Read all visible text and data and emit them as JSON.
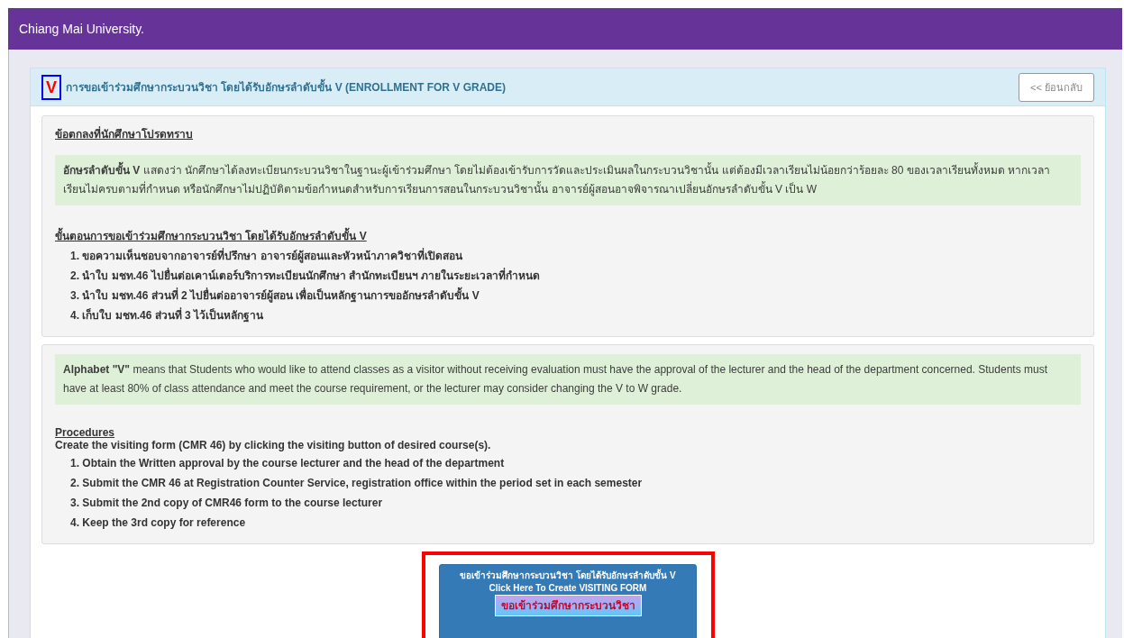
{
  "header": {
    "title": "Chiang Mai University."
  },
  "panel": {
    "badge": "V",
    "title": "การขอเข้าร่วมศึกษากระบวนวิชา โดยได้รับอักษรลำดับขั้น V (ENROLLMENT FOR V GRADE)",
    "back_button": "<< ย้อนกลับ"
  },
  "sections": [
    {
      "heading": "ข้อตกลงที่นักศึกษาโปรดทราบ",
      "notice": "**อักษรลำดับขั้น V** แสดงว่า นักศึกษาได้ลงทะเบียนกระบวนวิชาในฐานะผู้เข้าร่วมศึกษา โดยไม่ต้องเข้ารับการวัดและประเมินผลในกระบวนวิชานั้น แต่ต้องมีเวลาเรียนไม่น้อยกว่าร้อยละ 80 ของเวลาเรียนทั้งหมด หากเวลาเรียนไม่ครบตามที่กำหนด หรือนักศึกษาไม่ปฏิบัติตามข้อกำหนดสำหรับการเรียนการสอนในกระบวนวิชานั้น อาจารย์ผู้สอนอาจพิจารณาเปลี่ยนอักษรลำดับขั้น V เป็น W",
      "steps_heading": "ขั้นตอนการขอเข้าร่วมศึกษากระบวนวิชา โดยได้รับอักษรลำดับขั้น V",
      "steps": [
        "1. ขอความเห็นชอบจากอาจารย์ที่ปรึกษา อาจารย์ผู้สอนและหัวหน้าภาควิชาที่เปิดสอน",
        "2. นำใบ มชท.46 ไปยื่นต่อเคาน์เตอร์บริการทะเบียนนักศึกษา สำนักทะเบียนฯ ภายในระยะเวลาที่กำหนด",
        "3. นำใบ มชท.46 ส่วนที่ 2 ไปยื่นต่ออาจารย์ผู้สอน เพื่อเป็นหลักฐานการขออักษรลำดับขั้น V",
        "4. เก็บใบ มชท.46 ส่วนที่ 3 ไว้เป็นหลักฐาน"
      ]
    },
    {
      "notice": "**Alphabet \"V\"** means that Students who would like to attend classes as a visitor without receiving evaluation must have the approval of the lecturer and the head of the department concerned. Students must have at least 80% of class attendance and meet the course requirement, or the lecturer may consider changing the V to W grade.",
      "steps_heading": "Procedures",
      "intro": "Create the visiting form (CMR 46) by clicking the visiting button of desired course(s).",
      "steps": [
        "1. Obtain the Written approval by the course lecturer and the head of the department",
        "2. Submit the CMR 46 at Registration Counter Service, registration office within the period set in each semester",
        "3. Submit the 2nd copy of CMR46 form to the course lecturer",
        "4. Keep the 3rd copy for reference"
      ]
    }
  ],
  "visit_button": {
    "lines": [
      "ขอเข้าร่วมศึกษากระบวนวิชา โดยได้รับอักษรลำดับขั้น V",
      "Click Here To Create VISITING FORM"
    ],
    "banner": "ขอเข้าร่วมศึกษากระบวนวิชา"
  }
}
